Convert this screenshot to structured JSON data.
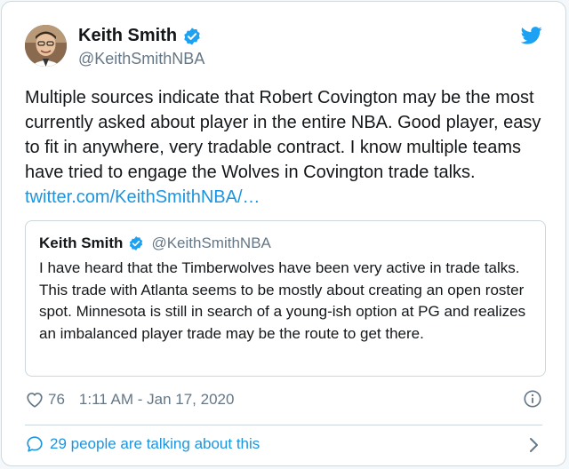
{
  "author": {
    "name": "Keith Smith",
    "handle": "@KeithSmithNBA",
    "avatar": "profile-photo"
  },
  "tweet": {
    "text": "Multiple sources indicate that Robert Covington may be the most currently asked about player in the entire NBA. Good player, easy to fit in anywhere, very tradable contract. I know multiple teams have tried to engage the Wolves in Covington trade talks.",
    "link": "twitter.com/KeithSmithNBA/…"
  },
  "quoted": {
    "name": "Keith Smith",
    "handle": "@KeithSmithNBA",
    "text": "I have heard that the Timberwolves have been very active in trade talks. This trade with Atlanta seems to be mostly about creating an open roster spot. Minnesota is still in search of a young-ish option at PG and realizes an imbalanced player trade may be the route to get there."
  },
  "meta": {
    "likes": "76",
    "timestamp": "1:11 AM - Jan 17, 2020"
  },
  "conversation": {
    "label": "29 people are talking about this"
  },
  "colors": {
    "accent": "#1da1f2",
    "link": "#1b95e0",
    "text": "#14171a",
    "muted": "#657786",
    "border": "#ccd6dd"
  },
  "icons": [
    "verified-badge-icon",
    "twitter-bird-icon",
    "heart-icon",
    "info-icon",
    "speech-bubble-icon",
    "chevron-right-icon"
  ]
}
